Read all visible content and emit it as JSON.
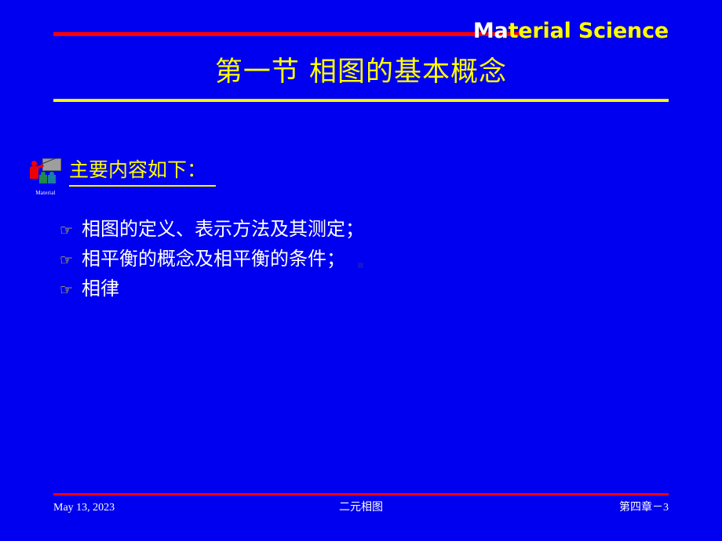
{
  "slide": {
    "background_color": "#0000f0",
    "header": {
      "brand_lead": "Ma",
      "brand_rest": "terial Science",
      "rule_color": "#ff0000"
    },
    "title": {
      "text": "第一节 相图的基本概念",
      "color": "#ffff00",
      "rule_color": "#ffff00"
    },
    "section": {
      "heading": "主要内容如下：",
      "heading_color": "#ffff00",
      "clipart_caption": "Material",
      "clipart_name": "presenter-lecture-clipart"
    },
    "bullets": [
      {
        "marker": "☞",
        "text": "相图的定义、表示方法及其测定；"
      },
      {
        "marker": "☞",
        "text": "相平衡的概念及相平衡的条件；"
      },
      {
        "marker": "☞",
        "text": "相律"
      }
    ],
    "footer": {
      "date": "May 13, 2023",
      "center": "二元相图",
      "page": "第四章－3",
      "rule_color": "#ff0000"
    }
  }
}
